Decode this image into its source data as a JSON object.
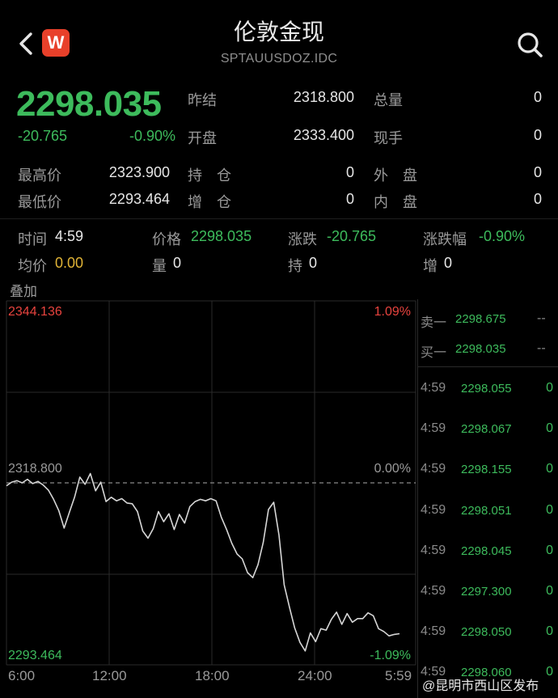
{
  "header": {
    "title": "伦敦金现",
    "subtitle": "SPTAUUSDOZ.IDC",
    "logo_text": "W"
  },
  "quote": {
    "price": "2298.035",
    "change": "-20.765",
    "change_pct": "-0.90%",
    "prev_close_label": "昨结",
    "prev_close": "2318.800",
    "open_label": "开盘",
    "open": "2333.400",
    "total_vol_label": "总量",
    "total_vol": "0",
    "cur_hand_label": "现手",
    "cur_hand": "0",
    "high_label": "最高价",
    "high": "2323.900",
    "low_label": "最低价",
    "low": "2293.464",
    "hold_label": "持　仓",
    "hold": "0",
    "add_label": "增　仓",
    "add": "0",
    "outer_label": "外　盘",
    "outer": "0",
    "inner_label": "内　盘",
    "inner": "0"
  },
  "cursor": {
    "time_label": "时间",
    "time": "4:59",
    "price_label": "价格",
    "price": "2298.035",
    "change_label": "涨跌",
    "change": "-20.765",
    "pct_label": "涨跌幅",
    "pct": "-0.90%",
    "avg_label": "均价",
    "avg": "0.00",
    "vol_label": "量",
    "vol": "0",
    "hold_label": "持",
    "hold": "0",
    "add_label": "增",
    "add": "0"
  },
  "overlay_label": "叠加",
  "chart": {
    "top_price": "2344.136",
    "top_pct": "1.09%",
    "mid_price": "2318.800",
    "mid_pct": "0.00%",
    "bottom_price": "2293.464",
    "bottom_pct": "-1.09%",
    "x_labels": [
      "6:00",
      "12:00",
      "18:00",
      "24:00",
      "5:59"
    ]
  },
  "chart_data": {
    "type": "line",
    "x_ticks": [
      "6:00",
      "12:00",
      "18:00",
      "24:00",
      "5:59"
    ],
    "ylim": [
      2293.464,
      2344.136
    ],
    "reference": 2318.8,
    "series": [
      {
        "values": [
          2318.4,
          2318.9,
          2319.1,
          2318.8,
          2319.3,
          2318.7,
          2319.0,
          2318.5,
          2317.8,
          2316.5,
          2314.9,
          2312.5,
          2314.7,
          2316.8,
          2319.6,
          2318.6,
          2320.1,
          2317.7,
          2318.9,
          2316.2,
          2316.8,
          2316.3,
          2316.6,
          2316.0,
          2315.9,
          2314.8,
          2312.1,
          2311.1,
          2312.4,
          2314.8,
          2313.4,
          2314.5,
          2312.3,
          2314.4,
          2313.2,
          2315.5,
          2316.2,
          2316.5,
          2316.3,
          2316.6,
          2316.3,
          2314.0,
          2312.3,
          2310.4,
          2308.9,
          2308.2,
          2306.3,
          2305.6,
          2307.4,
          2310.5,
          2315.1,
          2316.1,
          2311.5,
          2304.6,
          2301.5,
          2298.6,
          2296.6,
          2295.4,
          2297.9,
          2296.7,
          2298.5,
          2298.3,
          2299.8,
          2300.8,
          2299.1,
          2300.6,
          2299.4,
          2299.9,
          2299.9,
          2300.7,
          2300.3,
          2298.5,
          2298.1,
          2297.5,
          2297.7,
          2297.8
        ]
      }
    ]
  },
  "depth": {
    "sell1_label": "卖一",
    "sell1_price": "2298.675",
    "sell1_vol": "--",
    "buy1_label": "买一",
    "buy1_price": "2298.035",
    "buy1_vol": "--",
    "ticks": [
      {
        "time": "4:59",
        "price": "2298.055",
        "vol": "0"
      },
      {
        "time": "4:59",
        "price": "2298.067",
        "vol": "0"
      },
      {
        "time": "4:59",
        "price": "2298.155",
        "vol": "0"
      },
      {
        "time": "4:59",
        "price": "2298.051",
        "vol": "0"
      },
      {
        "time": "4:59",
        "price": "2298.045",
        "vol": "0"
      },
      {
        "time": "4:59",
        "price": "2297.300",
        "vol": "0"
      },
      {
        "time": "4:59",
        "price": "2298.050",
        "vol": "0"
      },
      {
        "time": "4:59",
        "price": "2298.060",
        "vol": "0"
      }
    ]
  },
  "watermark": "@昆明市西山区发布",
  "colors": {
    "up": "#e8433e",
    "down": "#3dbb5c",
    "line": "#d6d6d6",
    "logo": "#e8402a"
  }
}
